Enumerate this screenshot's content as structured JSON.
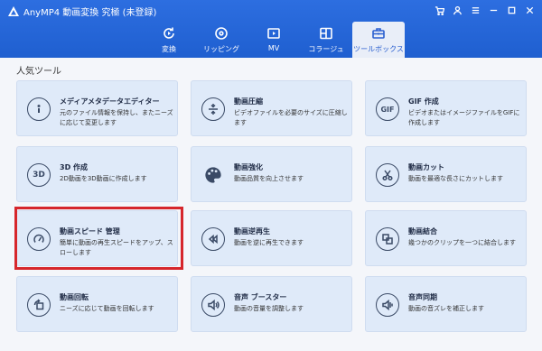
{
  "app": {
    "title": "AnyMP4 動画変換 究極 (未登録)",
    "accent": "#1f5fd0",
    "window_controls": [
      {
        "icon": "cart-icon"
      },
      {
        "icon": "user-icon"
      },
      {
        "icon": "menu-icon"
      },
      {
        "icon": "minimize-icon"
      },
      {
        "icon": "maximize-icon"
      },
      {
        "icon": "close-icon"
      }
    ]
  },
  "tabs": [
    {
      "label": "変換",
      "icon": "convert-icon",
      "active": false
    },
    {
      "label": "リッピング",
      "icon": "disc-icon",
      "active": false
    },
    {
      "label": "MV",
      "icon": "mv-icon",
      "active": false
    },
    {
      "label": "コラージュ",
      "icon": "collage-icon",
      "active": false
    },
    {
      "label": "ツールボックス",
      "icon": "toolbox-icon",
      "active": true
    }
  ],
  "section_title": "人気ツール",
  "tools": [
    {
      "title": "メディアメタデータエディター",
      "desc": "元のファイル情報を保持し、またニーズに応じて変更します",
      "icon": "info-icon"
    },
    {
      "title": "動画圧縮",
      "desc": "ビデオファイルを必要のサイズに圧縮します",
      "icon": "compress-icon"
    },
    {
      "title": "GIF 作成",
      "desc": "ビデオまたはイメージファイルをGIFに作成します",
      "icon": "gif-icon",
      "icon_text": "GIF"
    },
    {
      "title": "3D 作成",
      "desc": "2D動画を3D動画に作成します",
      "icon": "3d-icon",
      "icon_text": "3D"
    },
    {
      "title": "動画強化",
      "desc": "動画品質を向上させます",
      "icon": "palette-icon"
    },
    {
      "title": "動画カット",
      "desc": "動画を最適な長さにカットします",
      "icon": "scissors-icon"
    },
    {
      "title": "動画スピード 管理",
      "desc": "簡単に動画の再生スピードをアップ、スローします",
      "icon": "speedometer-icon"
    },
    {
      "title": "動画逆再生",
      "desc": "動画を逆に再生できます",
      "icon": "rewind-icon"
    },
    {
      "title": "動画結合",
      "desc": "幾つかのクリップを一つに結合します",
      "icon": "merge-icon"
    },
    {
      "title": "動画回転",
      "desc": "ニーズに応じて動画を回転します",
      "icon": "rotate-icon"
    },
    {
      "title": "音声 ブースター",
      "desc": "動画の音量を調整します",
      "icon": "volume-icon"
    },
    {
      "title": "音声同期",
      "desc": "動画の音ズレを補正します",
      "icon": "audio-sync-icon"
    }
  ]
}
